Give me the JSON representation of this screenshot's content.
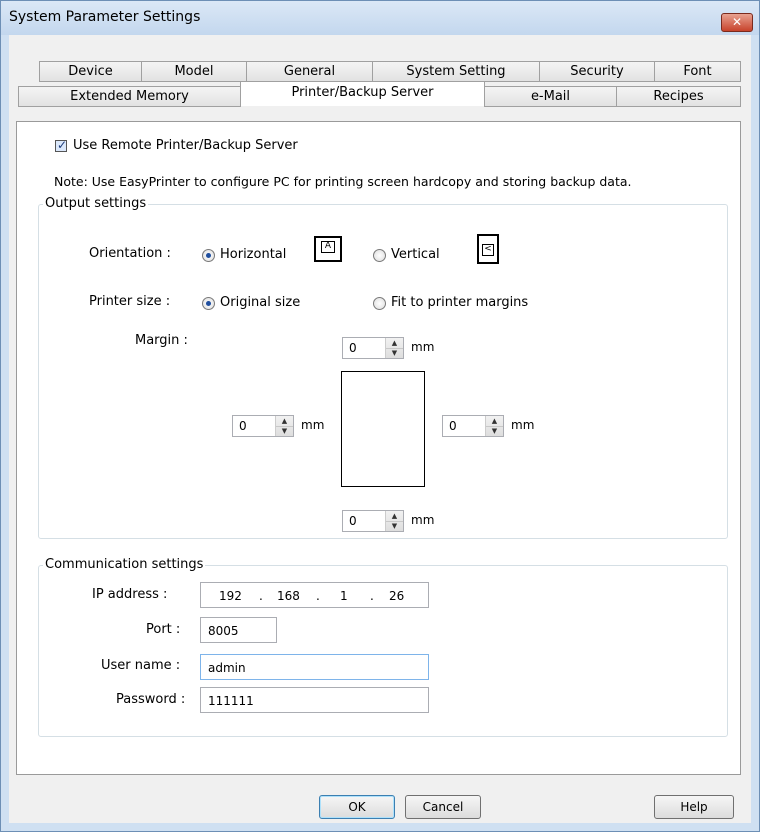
{
  "window": {
    "title": "System Parameter Settings",
    "close_glyph": "✕"
  },
  "tabs_row1": [
    "Device",
    "Model",
    "General",
    "System Setting",
    "Security",
    "Font"
  ],
  "tabs_row2": [
    "Extended Memory",
    "Printer/Backup Server",
    "e-Mail",
    "Recipes"
  ],
  "active_tab": "Printer/Backup Server",
  "use_remote": {
    "label": "Use Remote Printer/Backup Server",
    "checked": true
  },
  "note": "Note: Use EasyPrinter to configure PC for printing screen hardcopy and storing backup data.",
  "output": {
    "group_label": "Output settings",
    "orientation_label": "Orientation :",
    "horizontal_label": "Horizontal",
    "vertical_label": "Vertical",
    "orientation_selected": "Horizontal",
    "printer_size_label": "Printer size :",
    "original_size_label": "Original size",
    "fit_label": "Fit to printer margins",
    "printer_size_selected": "Original size",
    "margin_label": "Margin :",
    "margin_top": "0",
    "margin_left": "0",
    "margin_right": "0",
    "margin_bottom": "0",
    "unit": "mm"
  },
  "comm": {
    "group_label": "Communication settings",
    "ip_label": "IP address :",
    "ip_1": "192",
    "ip_2": "168",
    "ip_3": "1",
    "ip_4": "26",
    "ip_sep": ".",
    "port_label": "Port :",
    "port": "8005",
    "user_label": "User name :",
    "user": "admin",
    "password_label": "Password :",
    "password": "111111"
  },
  "buttons": {
    "ok": "OK",
    "cancel": "Cancel",
    "help": "Help"
  }
}
